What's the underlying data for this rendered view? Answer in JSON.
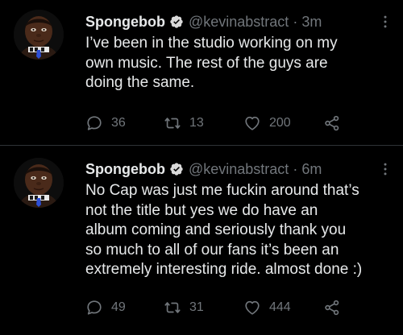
{
  "colors": {
    "background": "#000000",
    "text_primary": "#e7e9ea",
    "text_secondary": "#71767b",
    "verified_badge": "#d9d9d9",
    "divider": "#2f3336"
  },
  "tweets": [
    {
      "author_name": "Spongebob",
      "handle": "@kevinabstract",
      "separator": "·",
      "time": "3m",
      "text": "I’ve been in the studio working on my\nown music. The rest of the guys are\ndoing the same.",
      "reply_count": "36",
      "retweet_count": "13",
      "like_count": "200",
      "icons": {
        "verified": "verified-badge-icon",
        "more": "more-dots-icon",
        "reply": "reply-icon",
        "retweet": "retweet-icon",
        "like": "heart-icon",
        "share": "share-icon"
      }
    },
    {
      "author_name": "Spongebob",
      "handle": "@kevinabstract",
      "separator": "·",
      "time": "6m",
      "text": "No Cap was just me fuckin around that’s\nnot the title but yes we do have an\nalbum coming and seriously thank you\nso much to all of our fans it’s been an\nextremely interesting ride. almost done :)",
      "reply_count": "49",
      "retweet_count": "31",
      "like_count": "444",
      "icons": {
        "verified": "verified-badge-icon",
        "more": "more-dots-icon",
        "reply": "reply-icon",
        "retweet": "retweet-icon",
        "like": "heart-icon",
        "share": "share-icon"
      }
    }
  ]
}
